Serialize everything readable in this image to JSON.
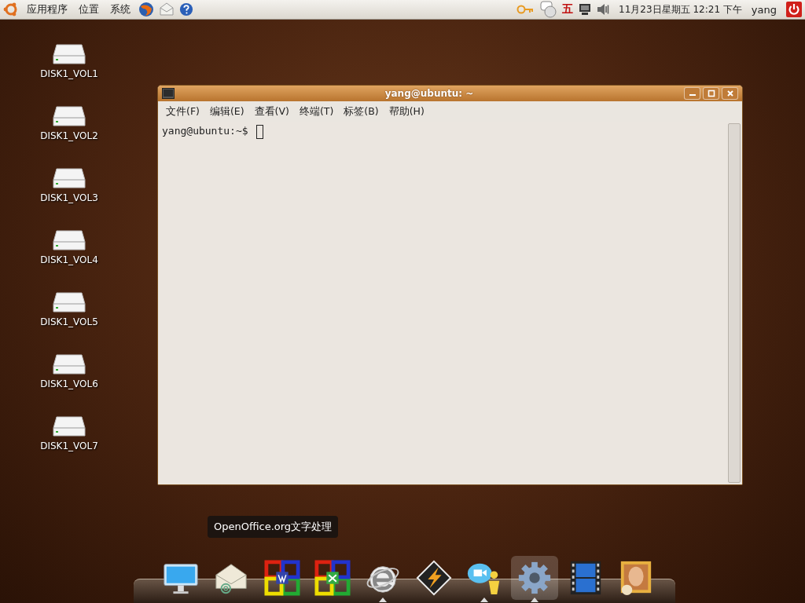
{
  "top_panel": {
    "menus": [
      "应用程序",
      "位置",
      "系统"
    ],
    "launchers": [
      {
        "kind": "firefox"
      },
      {
        "kind": "mail"
      },
      {
        "kind": "help"
      }
    ],
    "tray": [
      {
        "kind": "keys"
      },
      {
        "kind": "chat"
      },
      {
        "kind": "input",
        "text": "五"
      },
      {
        "kind": "network"
      },
      {
        "kind": "volume"
      }
    ],
    "clock": "11月23日星期五 12:21 下午",
    "user": "yang"
  },
  "desktop_icons": [
    {
      "label": "DISK1_VOL1"
    },
    {
      "label": "DISK1_VOL2"
    },
    {
      "label": "DISK1_VOL3"
    },
    {
      "label": "DISK1_VOL4"
    },
    {
      "label": "DISK1_VOL5"
    },
    {
      "label": "DISK1_VOL6"
    },
    {
      "label": "DISK1_VOL7"
    }
  ],
  "terminal": {
    "title": "yang@ubuntu: ~",
    "menus": [
      "文件(F)",
      "编辑(E)",
      "查看(V)",
      "终端(T)",
      "标签(B)",
      "帮助(H)"
    ],
    "prompt": "yang@ubuntu:~$"
  },
  "dock": {
    "tooltip": "OpenOffice.org文字处理",
    "items": [
      {
        "kind": "monitor",
        "running": false,
        "selected": false
      },
      {
        "kind": "mail",
        "running": false,
        "selected": false
      },
      {
        "kind": "office-writer",
        "running": false,
        "selected": false
      },
      {
        "kind": "office-calc",
        "running": false,
        "selected": false
      },
      {
        "kind": "browser",
        "running": true,
        "selected": false
      },
      {
        "kind": "player",
        "running": false,
        "selected": false
      },
      {
        "kind": "chat",
        "running": true,
        "selected": false
      },
      {
        "kind": "gear",
        "running": true,
        "selected": true
      },
      {
        "kind": "film",
        "running": false,
        "selected": false
      },
      {
        "kind": "portrait",
        "running": false,
        "selected": false
      }
    ]
  }
}
